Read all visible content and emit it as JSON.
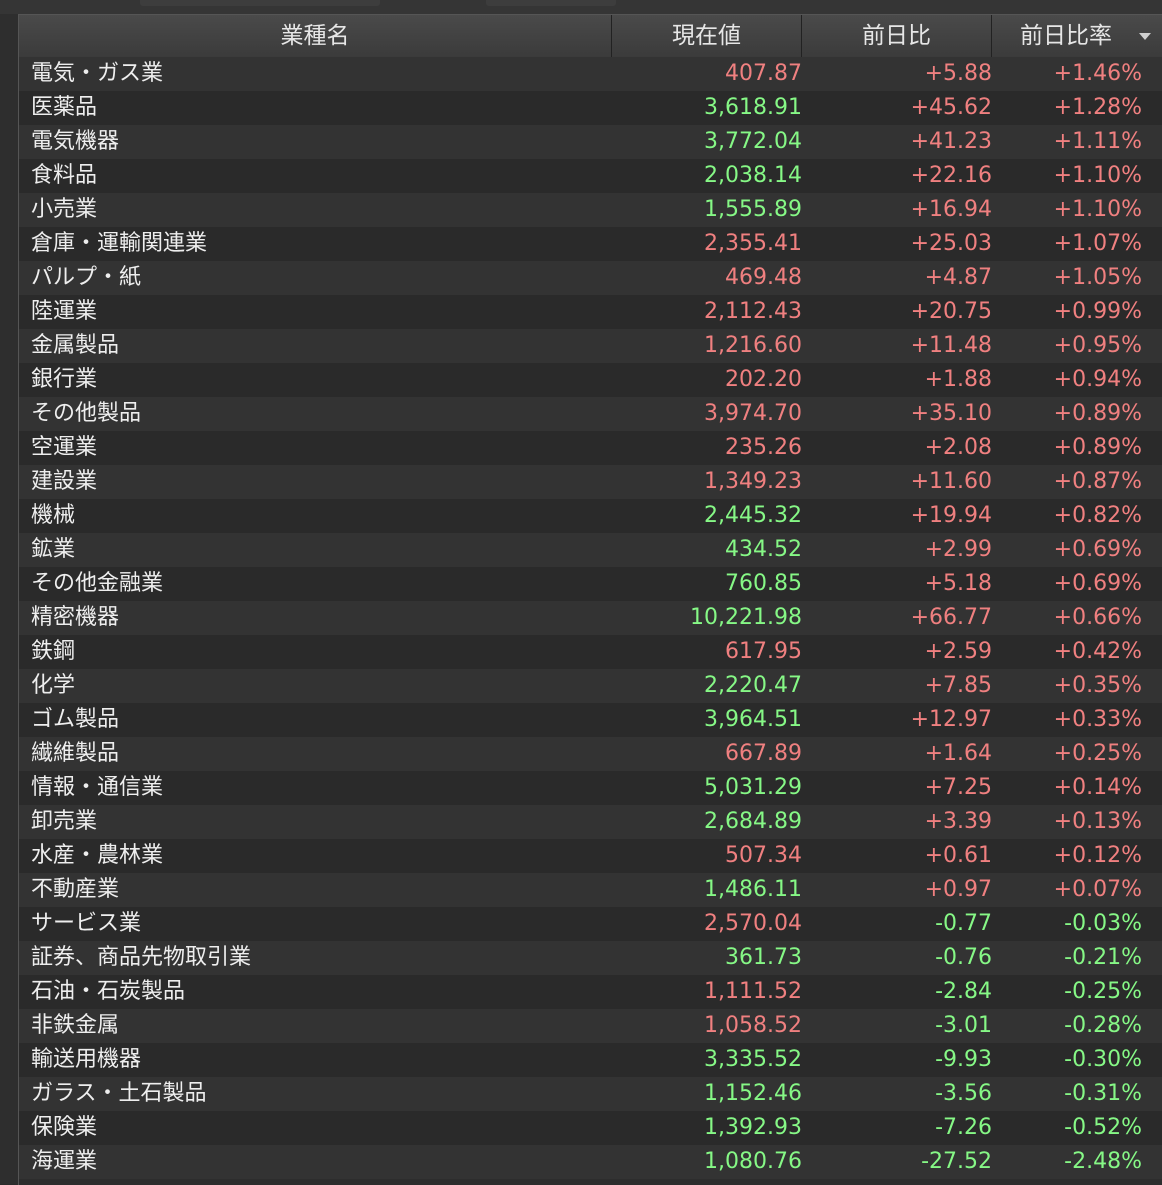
{
  "colors": {
    "red": "#f08080",
    "green": "#86f886",
    "header_text": "#e6e6e6",
    "row_text": "#eeeeee"
  },
  "header": {
    "col_name": "業種名",
    "col_price": "現在値",
    "col_change": "前日比",
    "col_rate": "前日比率",
    "sort_icon": "chevron-down-icon"
  },
  "rows": [
    {
      "name": "電気・ガス業",
      "price": "407.87",
      "price_color": "red",
      "change": "+5.88",
      "rate": "+1.46%"
    },
    {
      "name": "医薬品",
      "price": "3,618.91",
      "price_color": "green",
      "change": "+45.62",
      "rate": "+1.28%"
    },
    {
      "name": "電気機器",
      "price": "3,772.04",
      "price_color": "green",
      "change": "+41.23",
      "rate": "+1.11%"
    },
    {
      "name": "食料品",
      "price": "2,038.14",
      "price_color": "green",
      "change": "+22.16",
      "rate": "+1.10%"
    },
    {
      "name": "小売業",
      "price": "1,555.89",
      "price_color": "green",
      "change": "+16.94",
      "rate": "+1.10%"
    },
    {
      "name": "倉庫・運輸関連業",
      "price": "2,355.41",
      "price_color": "red",
      "change": "+25.03",
      "rate": "+1.07%"
    },
    {
      "name": "パルプ・紙",
      "price": "469.48",
      "price_color": "red",
      "change": "+4.87",
      "rate": "+1.05%"
    },
    {
      "name": "陸運業",
      "price": "2,112.43",
      "price_color": "red",
      "change": "+20.75",
      "rate": "+0.99%"
    },
    {
      "name": "金属製品",
      "price": "1,216.60",
      "price_color": "red",
      "change": "+11.48",
      "rate": "+0.95%"
    },
    {
      "name": "銀行業",
      "price": "202.20",
      "price_color": "red",
      "change": "+1.88",
      "rate": "+0.94%"
    },
    {
      "name": "その他製品",
      "price": "3,974.70",
      "price_color": "red",
      "change": "+35.10",
      "rate": "+0.89%"
    },
    {
      "name": "空運業",
      "price": "235.26",
      "price_color": "red",
      "change": "+2.08",
      "rate": "+0.89%"
    },
    {
      "name": "建設業",
      "price": "1,349.23",
      "price_color": "red",
      "change": "+11.60",
      "rate": "+0.87%"
    },
    {
      "name": "機械",
      "price": "2,445.32",
      "price_color": "green",
      "change": "+19.94",
      "rate": "+0.82%"
    },
    {
      "name": "鉱業",
      "price": "434.52",
      "price_color": "green",
      "change": "+2.99",
      "rate": "+0.69%"
    },
    {
      "name": "その他金融業",
      "price": "760.85",
      "price_color": "green",
      "change": "+5.18",
      "rate": "+0.69%"
    },
    {
      "name": "精密機器",
      "price": "10,221.98",
      "price_color": "green",
      "change": "+66.77",
      "rate": "+0.66%"
    },
    {
      "name": "鉄鋼",
      "price": "617.95",
      "price_color": "red",
      "change": "+2.59",
      "rate": "+0.42%"
    },
    {
      "name": "化学",
      "price": "2,220.47",
      "price_color": "green",
      "change": "+7.85",
      "rate": "+0.35%"
    },
    {
      "name": "ゴム製品",
      "price": "3,964.51",
      "price_color": "green",
      "change": "+12.97",
      "rate": "+0.33%"
    },
    {
      "name": "繊維製品",
      "price": "667.89",
      "price_color": "red",
      "change": "+1.64",
      "rate": "+0.25%"
    },
    {
      "name": "情報・通信業",
      "price": "5,031.29",
      "price_color": "green",
      "change": "+7.25",
      "rate": "+0.14%"
    },
    {
      "name": "卸売業",
      "price": "2,684.89",
      "price_color": "green",
      "change": "+3.39",
      "rate": "+0.13%"
    },
    {
      "name": "水産・農林業",
      "price": "507.34",
      "price_color": "red",
      "change": "+0.61",
      "rate": "+0.12%"
    },
    {
      "name": "不動産業",
      "price": "1,486.11",
      "price_color": "green",
      "change": "+0.97",
      "rate": "+0.07%"
    },
    {
      "name": "サービス業",
      "price": "2,570.04",
      "price_color": "red",
      "change": "-0.77",
      "rate": "-0.03%"
    },
    {
      "name": "証券、商品先物取引業",
      "price": "361.73",
      "price_color": "green",
      "change": "-0.76",
      "rate": "-0.21%"
    },
    {
      "name": "石油・石炭製品",
      "price": "1,111.52",
      "price_color": "red",
      "change": "-2.84",
      "rate": "-0.25%"
    },
    {
      "name": "非鉄金属",
      "price": "1,058.52",
      "price_color": "red",
      "change": "-3.01",
      "rate": "-0.28%"
    },
    {
      "name": "輸送用機器",
      "price": "3,335.52",
      "price_color": "green",
      "change": "-9.93",
      "rate": "-0.30%"
    },
    {
      "name": "ガラス・土石製品",
      "price": "1,152.46",
      "price_color": "green",
      "change": "-3.56",
      "rate": "-0.31%"
    },
    {
      "name": "保険業",
      "price": "1,392.93",
      "price_color": "green",
      "change": "-7.26",
      "rate": "-0.52%"
    },
    {
      "name": "海運業",
      "price": "1,080.76",
      "price_color": "green",
      "change": "-27.52",
      "rate": "-2.48%"
    }
  ]
}
